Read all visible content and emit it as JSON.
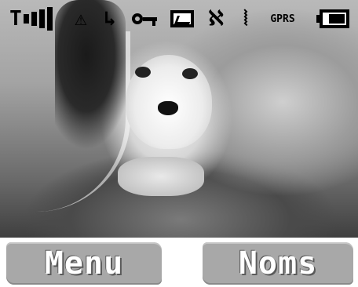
{
  "statusbar": {
    "icons": [
      {
        "name": "signal-strength-icon",
        "glyph": "T",
        "level": 4,
        "max": 4
      },
      {
        "name": "network-alert-icon",
        "glyph": "⚠"
      },
      {
        "name": "call-divert-icon",
        "glyph": "↳"
      },
      {
        "name": "key-lock-icon"
      },
      {
        "name": "message-envelope-icon"
      },
      {
        "name": "bluetooth-icon",
        "glyph": "ℵ"
      },
      {
        "name": "vibrate-icon",
        "glyph": "⦚"
      },
      {
        "name": "gprs-indicator",
        "text": "GPRS"
      },
      {
        "name": "battery-icon",
        "level": 0.75
      }
    ]
  },
  "softkeys": {
    "left_label": "Menu",
    "right_label": "Noms"
  },
  "colors": {
    "softkey_bg": "#a8a8a8",
    "softkey_text": "#ffffff"
  }
}
